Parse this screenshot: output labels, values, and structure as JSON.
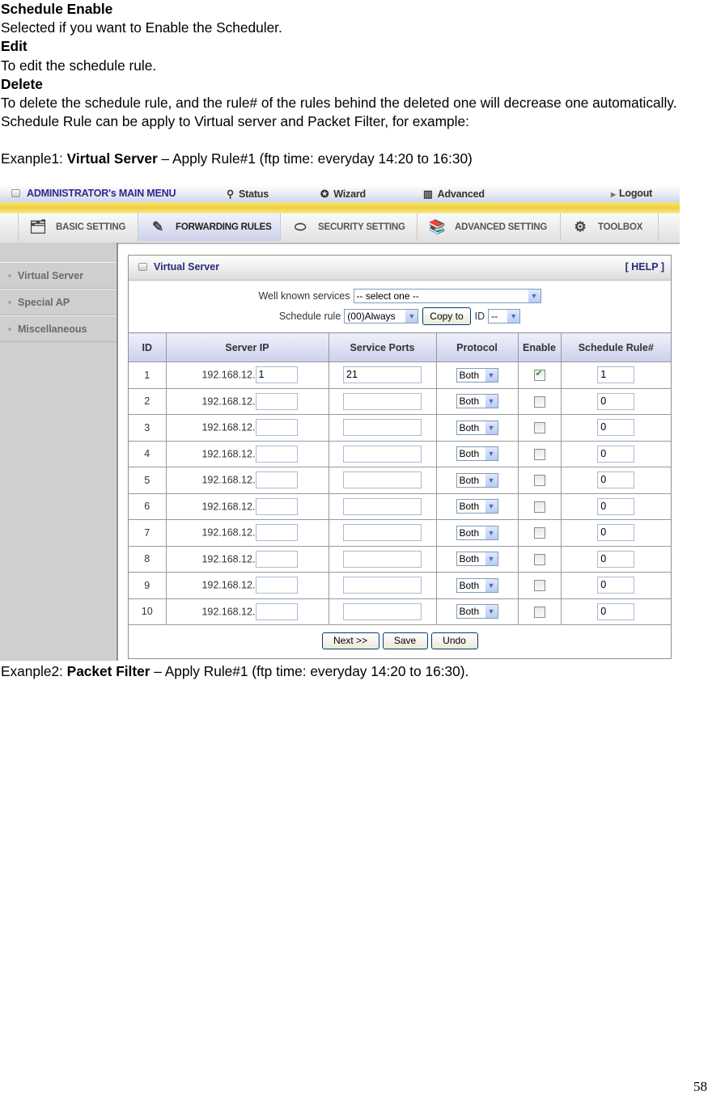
{
  "document": {
    "sections": [
      {
        "heading": "Schedule Enable",
        "text": "Selected if you want to Enable the Scheduler."
      },
      {
        "heading": "Edit",
        "text": "To edit the schedule rule."
      },
      {
        "heading": "Delete",
        "text": "To delete the schedule rule, and the rule# of the rules behind the deleted one will decrease one automatically."
      }
    ],
    "intro": "Schedule Rule can be apply to Virtual server and Packet Filter, for example:",
    "example1": {
      "prefix": "Exanple1: ",
      "bold": "Virtual Server",
      "suffix": " – Apply Rule#1 (ftp time: everyday 14:20 to 16:30)"
    },
    "example2": {
      "prefix": "Exanple2: ",
      "bold": "Packet Filter",
      "suffix": " – Apply Rule#1 (ftp time: everyday 14:20 to 16:30)."
    },
    "page_number": "58"
  },
  "router_ui": {
    "topbar": {
      "admin_menu": "ADMINISTRATOR's MAIN MENU",
      "status": "Status",
      "wizard": "Wizard",
      "advanced": "Advanced",
      "logout": "Logout"
    },
    "tabs": [
      {
        "label": "BASIC SETTING",
        "icon": "folder-icon"
      },
      {
        "label": "FORWARDING RULES",
        "icon": "forwarding-icon",
        "active": true
      },
      {
        "label": "SECURITY SETTING",
        "icon": "lock-icon"
      },
      {
        "label": "ADVANCED SETTING",
        "icon": "books-icon"
      },
      {
        "label": "TOOLBOX",
        "icon": "toolbox-icon"
      }
    ],
    "sidebar": [
      {
        "label": "Virtual Server"
      },
      {
        "label": "Special AP"
      },
      {
        "label": "Miscellaneous"
      }
    ],
    "panel": {
      "title": "Virtual Server",
      "help": "[ HELP ]",
      "well_known_label": "Well known services",
      "well_known_value": "-- select one --",
      "schedule_label": "Schedule rule",
      "schedule_value": "(00)Always",
      "copy_to": "Copy to",
      "id_label": "ID",
      "id_value": "--"
    },
    "table": {
      "headers": [
        "ID",
        "Server IP",
        "Service Ports",
        "Protocol",
        "Enable",
        "Schedule Rule#"
      ],
      "ip_prefix": "192.168.12.",
      "rows": [
        {
          "id": "1",
          "ip": "1",
          "ports": "21",
          "protocol": "Both",
          "enabled": true,
          "rule": "1"
        },
        {
          "id": "2",
          "ip": "",
          "ports": "",
          "protocol": "Both",
          "enabled": false,
          "rule": "0"
        },
        {
          "id": "3",
          "ip": "",
          "ports": "",
          "protocol": "Both",
          "enabled": false,
          "rule": "0"
        },
        {
          "id": "4",
          "ip": "",
          "ports": "",
          "protocol": "Both",
          "enabled": false,
          "rule": "0"
        },
        {
          "id": "5",
          "ip": "",
          "ports": "",
          "protocol": "Both",
          "enabled": false,
          "rule": "0"
        },
        {
          "id": "6",
          "ip": "",
          "ports": "",
          "protocol": "Both",
          "enabled": false,
          "rule": "0"
        },
        {
          "id": "7",
          "ip": "",
          "ports": "",
          "protocol": "Both",
          "enabled": false,
          "rule": "0"
        },
        {
          "id": "8",
          "ip": "",
          "ports": "",
          "protocol": "Both",
          "enabled": false,
          "rule": "0"
        },
        {
          "id": "9",
          "ip": "",
          "ports": "",
          "protocol": "Both",
          "enabled": false,
          "rule": "0"
        },
        {
          "id": "10",
          "ip": "",
          "ports": "",
          "protocol": "Both",
          "enabled": false,
          "rule": "0"
        }
      ]
    },
    "buttons": {
      "next": "Next >>",
      "save": "Save",
      "undo": "Undo"
    }
  }
}
